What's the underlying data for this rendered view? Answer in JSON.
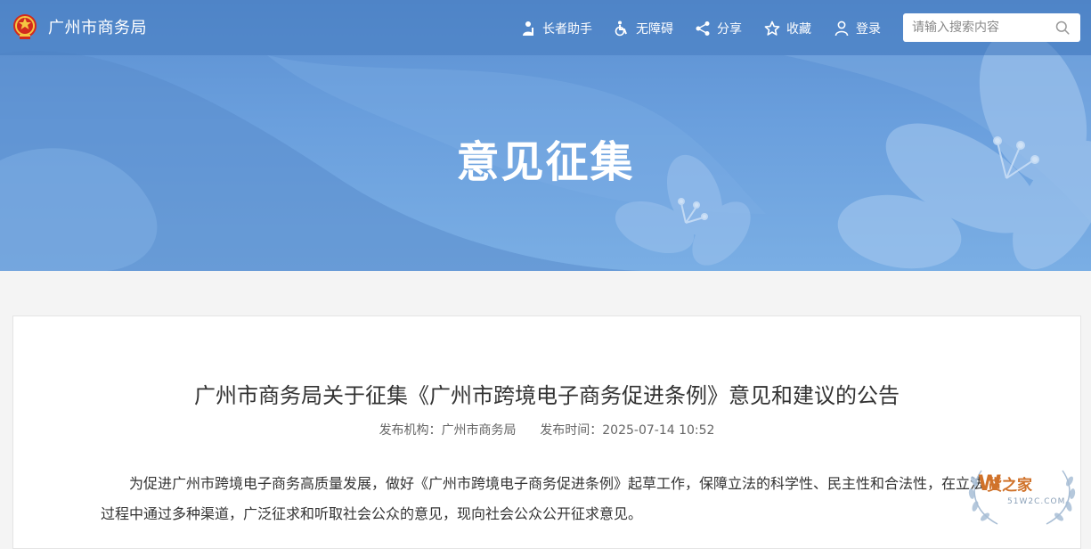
{
  "header": {
    "site_name": "广州市商务局",
    "nav": {
      "elder_label": "长者助手",
      "accessibility_label": "无障碍",
      "share_label": "分享",
      "favorite_label": "收藏",
      "login_label": "登录"
    },
    "search": {
      "placeholder": "请输入搜索内容"
    }
  },
  "banner": {
    "title": "意见征集"
  },
  "article": {
    "title": "广州市商务局关于征集《广州市跨境电子商务促进条例》意见和建议的公告",
    "publisher_label": "发布机构：",
    "publisher": "广州市商务局",
    "date_label": "发布时间：",
    "date": "2025-07-14 10:52",
    "body": "为促进广州市跨境电子商务高质量发展，做好《广州市跨境电子商务促进条例》起草工作，保障立法的科学性、民主性和合法性，在立法过程中通过多种渠道，广泛征求和听取社会公众的意见，现向社会公众公开征求意见。"
  },
  "watermark": {
    "text": "货之家",
    "sub": "51W2C.COM"
  },
  "colors": {
    "banner": "#6a9fdd",
    "topbar": "#467cc0",
    "text": "#333333",
    "meta": "#666666"
  }
}
